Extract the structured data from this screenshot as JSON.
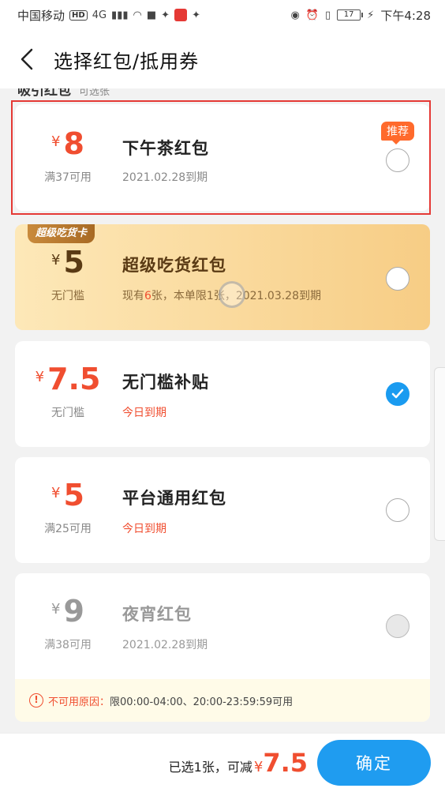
{
  "status_bar": {
    "carrier": "中国移动",
    "hd": "HD",
    "network": "4G",
    "battery": "17",
    "time": "下午4:28"
  },
  "header": {
    "title": "选择红包/抵用券"
  },
  "section": {
    "title": "吸引红包",
    "subtitle": "可选张"
  },
  "cards": [
    {
      "yen": "¥",
      "amount": "8",
      "threshold": "满37可用",
      "name": "下午茶红包",
      "desc": "2021.02.28到期",
      "tag": "推荐",
      "checked": false
    },
    {
      "yen": "¥",
      "amount": "5",
      "threshold": "无门槛",
      "name": "超级吃货红包",
      "desc_pre": "现有",
      "desc_count": "6",
      "desc_post": "张，本单限1张，2021.03.28到期",
      "badge": "超级吃货卡",
      "checked": false
    },
    {
      "yen": "¥",
      "amount": "7.5",
      "threshold": "无门槛",
      "name": "无门槛补贴",
      "desc": "今日到期",
      "checked": true
    },
    {
      "yen": "¥",
      "amount": "5",
      "threshold": "满25可用",
      "name": "平台通用红包",
      "desc": "今日到期",
      "checked": false
    },
    {
      "yen": "¥",
      "amount": "9",
      "threshold": "满38可用",
      "name": "夜宵红包",
      "desc": "2021.02.28到期",
      "checked": false,
      "disabled": true,
      "reason_label": "不可用原因：",
      "reason_text": "限00:00-04:00、20:00-23:59:59可用"
    }
  ],
  "footer": {
    "summary": "已选1张，可减",
    "yen": "¥",
    "value": "7.5",
    "confirm": "确定"
  },
  "colors": {
    "accent_red": "#f04e30",
    "brand_blue": "#1f9cf0",
    "gold": "#f7cd85"
  }
}
